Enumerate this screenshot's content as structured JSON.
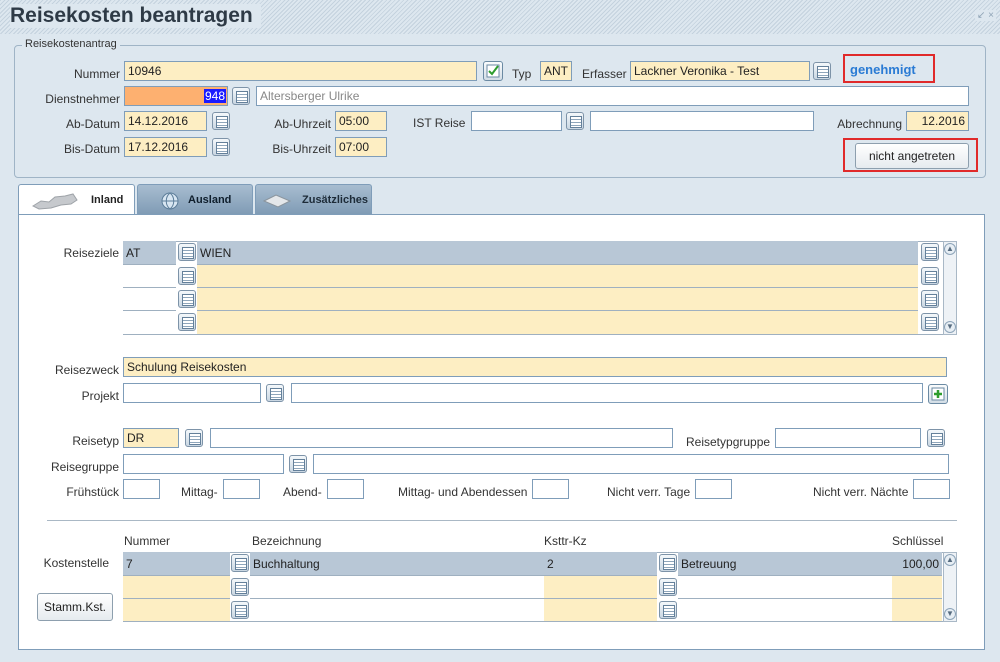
{
  "window": {
    "title": "Reisekosten beantragen",
    "controls": "↙ ×"
  },
  "antrag": {
    "legend": "Reisekostenantrag",
    "nummer_label": "Nummer",
    "nummer": "10946",
    "typ_label": "Typ",
    "typ": "ANT",
    "erfasser_label": "Erfasser",
    "erfasser": "Lackner Veronika - Test",
    "status_link": "genehmigt",
    "dienstnehmer_label": "Dienstnehmer",
    "dienstnehmer_nr": "948",
    "dienstnehmer_name": "Altersberger Ulrike",
    "ab_datum_label": "Ab-Datum",
    "ab_datum": "14.12.2016",
    "ab_uhrzeit_label": "Ab-Uhrzeit",
    "ab_uhrzeit": "05:00",
    "ist_reise_label": "IST Reise",
    "abrechnung_label": "Abrechnung",
    "abrechnung": "12.2016",
    "bis_datum_label": "Bis-Datum",
    "bis_datum": "17.12.2016",
    "bis_uhrzeit_label": "Bis-Uhrzeit",
    "bis_uhrzeit": "07:00",
    "nicht_angetreten_button": "nicht angetreten"
  },
  "tabs": [
    {
      "label": "Inland",
      "icon": "austria-map-icon",
      "active": true
    },
    {
      "label": "Ausland",
      "icon": "globe-icon",
      "active": false
    },
    {
      "label": "Zusätzliches",
      "icon": "document-icon",
      "active": false
    }
  ],
  "inland": {
    "reiseziele_label": "Reiseziele",
    "reiseziele": [
      {
        "land": "AT",
        "ort": "WIEN"
      },
      {
        "land": "",
        "ort": ""
      },
      {
        "land": "",
        "ort": ""
      },
      {
        "land": "",
        "ort": ""
      }
    ],
    "reisezweck_label": "Reisezweck",
    "reisezweck": "Schulung Reisekosten",
    "projekt_label": "Projekt",
    "reisetyp_label": "Reisetyp",
    "reisetyp": "DR",
    "reisetypgruppe_label": "Reisetypgruppe",
    "reisegruppe_label": "Reisegruppe",
    "fruehstueck_label": "Frühstück",
    "mittag_label": "Mittag-",
    "abend_label": "Abend-",
    "mittag_abend_label": "Mittag- und Abendessen",
    "nicht_verr_tage_label": "Nicht verr. Tage",
    "nicht_verr_naechte_label": "Nicht verr. Nächte",
    "kosten_headers": {
      "nummer": "Nummer",
      "bezeichnung": "Bezeichnung",
      "ksttr": "Ksttr-Kz",
      "schluessel": "Schlüssel"
    },
    "kostenstelle_label": "Kostenstelle",
    "kostenstellen": [
      {
        "nummer": "7",
        "bezeichnung": "Buchhaltung",
        "ksttr": "2",
        "ksttr_bez": "Betreuung",
        "schluessel": "100,00"
      },
      {
        "nummer": "",
        "bezeichnung": "",
        "ksttr": "",
        "ksttr_bez": "",
        "schluessel": ""
      },
      {
        "nummer": "",
        "bezeichnung": "",
        "ksttr": "",
        "ksttr_bez": "",
        "schluessel": ""
      }
    ],
    "stamm_kst_button": "Stamm.Kst."
  },
  "colors": {
    "accent_link": "#2a7bd4",
    "highlight_red": "#e02a2a",
    "yellow_field": "#fdeec3",
    "orange_field": "#fdb070",
    "selection": "#1a1aff"
  }
}
